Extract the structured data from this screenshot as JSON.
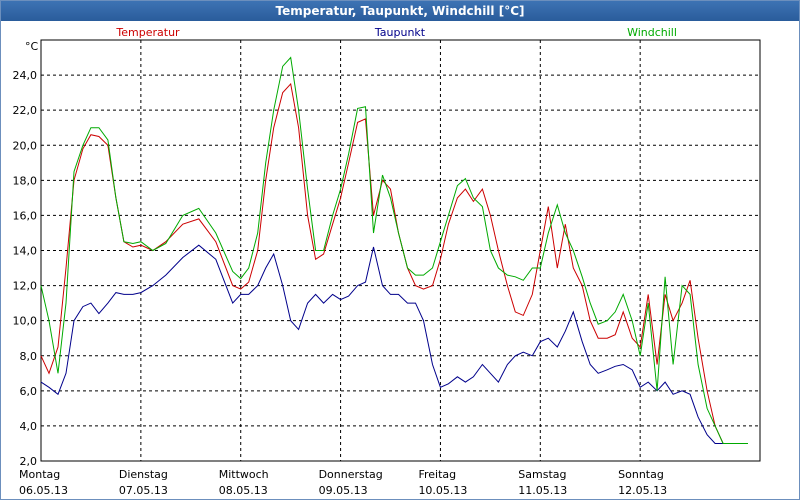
{
  "window": {
    "title": "Temperatur, Taupunkt, Windchill [°C]"
  },
  "chart_data": {
    "type": "line",
    "title": "Temperatur, Taupunkt, Windchill [°C]",
    "ylabel": "°C",
    "ylim": [
      2.0,
      26.0
    ],
    "xlim": [
      0,
      7.2
    ],
    "grid": true,
    "legend_position": "top",
    "y_ticks": [
      "2,0",
      "4,0",
      "6,0",
      "8,0",
      "10,0",
      "12,0",
      "14,0",
      "16,0",
      "18,0",
      "20,0",
      "22,0",
      "24,0"
    ],
    "x_ticks": [
      {
        "day": "Montag",
        "date": "06.05.13"
      },
      {
        "day": "Dienstag",
        "date": "07.05.13"
      },
      {
        "day": "Mittwoch",
        "date": "08.05.13"
      },
      {
        "day": "Donnerstag",
        "date": "09.05.13"
      },
      {
        "day": "Freitag",
        "date": "10.05.13"
      },
      {
        "day": "Samstag",
        "date": "11.05.13"
      },
      {
        "day": "Sonntag",
        "date": "12.05.13"
      }
    ],
    "series": [
      {
        "name": "Temperatur",
        "color": "#cc0000",
        "x": [
          0,
          0.08,
          0.17,
          0.25,
          0.33,
          0.42,
          0.5,
          0.58,
          0.67,
          0.75,
          0.83,
          0.92,
          1.0,
          1.12,
          1.25,
          1.42,
          1.58,
          1.75,
          1.92,
          2.0,
          2.08,
          2.17,
          2.25,
          2.33,
          2.42,
          2.5,
          2.58,
          2.67,
          2.75,
          2.83,
          2.92,
          3.0,
          3.08,
          3.17,
          3.25,
          3.33,
          3.42,
          3.5,
          3.58,
          3.67,
          3.75,
          3.83,
          3.92,
          4.0,
          4.08,
          4.17,
          4.25,
          4.33,
          4.42,
          4.5,
          4.58,
          4.67,
          4.75,
          4.83,
          4.92,
          5.0,
          5.08,
          5.17,
          5.25,
          5.33,
          5.42,
          5.5,
          5.58,
          5.67,
          5.75,
          5.83,
          5.92,
          6.0,
          6.08,
          6.17,
          6.25,
          6.33,
          6.42,
          6.5,
          6.58,
          6.67,
          6.75,
          6.83,
          6.92,
          7.0,
          7.08
        ],
        "values": [
          8.0,
          7.0,
          8.5,
          13.0,
          18.0,
          19.8,
          20.6,
          20.5,
          20.0,
          17.0,
          14.5,
          14.2,
          14.3,
          14.0,
          14.5,
          15.5,
          15.8,
          14.5,
          12.0,
          11.8,
          12.2,
          14.0,
          18.0,
          21.0,
          23.0,
          23.5,
          21.0,
          16.0,
          13.5,
          13.8,
          15.5,
          17.0,
          19.0,
          21.3,
          21.5,
          16.0,
          18.0,
          17.5,
          15.0,
          13.0,
          12.0,
          11.8,
          12.0,
          13.5,
          15.5,
          17.0,
          17.5,
          16.8,
          17.5,
          16.0,
          14.0,
          12.0,
          10.5,
          10.3,
          11.5,
          14.0,
          16.5,
          13.0,
          15.5,
          13.0,
          12.0,
          10.0,
          9.0,
          9.0,
          9.2,
          10.5,
          9.0,
          8.5,
          11.5,
          7.5,
          11.5,
          10.0,
          11.0,
          12.3,
          9.0,
          6.0,
          4.0,
          3.0,
          3.0,
          3.0,
          3.0
        ]
      },
      {
        "name": "Taupunkt",
        "color": "#00008b",
        "x": [
          0,
          0.08,
          0.17,
          0.25,
          0.33,
          0.42,
          0.5,
          0.58,
          0.67,
          0.75,
          0.83,
          0.92,
          1.0,
          1.12,
          1.25,
          1.42,
          1.58,
          1.75,
          1.92,
          2.0,
          2.08,
          2.17,
          2.25,
          2.33,
          2.42,
          2.5,
          2.58,
          2.67,
          2.75,
          2.83,
          2.92,
          3.0,
          3.08,
          3.17,
          3.25,
          3.33,
          3.42,
          3.5,
          3.58,
          3.67,
          3.75,
          3.83,
          3.92,
          4.0,
          4.08,
          4.17,
          4.25,
          4.33,
          4.42,
          4.5,
          4.58,
          4.67,
          4.75,
          4.83,
          4.92,
          5.0,
          5.08,
          5.17,
          5.25,
          5.33,
          5.42,
          5.5,
          5.58,
          5.67,
          5.75,
          5.83,
          5.92,
          6.0,
          6.08,
          6.17,
          6.25,
          6.33,
          6.42,
          6.5,
          6.58,
          6.67,
          6.75,
          6.83,
          6.92,
          7.0,
          7.08
        ],
        "values": [
          6.5,
          6.2,
          5.8,
          7.0,
          10.0,
          10.8,
          11.0,
          10.4,
          11.0,
          11.6,
          11.5,
          11.5,
          11.6,
          12.0,
          12.6,
          13.6,
          14.3,
          13.5,
          11.0,
          11.5,
          11.5,
          12.0,
          13.0,
          13.8,
          12.0,
          10.0,
          9.5,
          11.0,
          11.5,
          11.0,
          11.5,
          11.2,
          11.4,
          12.0,
          12.2,
          14.2,
          12.0,
          11.5,
          11.5,
          11.0,
          11.0,
          10.0,
          7.5,
          6.2,
          6.4,
          6.8,
          6.5,
          6.8,
          7.5,
          7.0,
          6.5,
          7.5,
          8.0,
          8.2,
          8.0,
          8.8,
          9.0,
          8.5,
          9.4,
          10.5,
          8.8,
          7.5,
          7.0,
          7.2,
          7.4,
          7.5,
          7.2,
          6.2,
          6.5,
          6.0,
          6.5,
          5.8,
          6.0,
          5.8,
          4.5,
          3.5,
          3.0,
          3.0,
          3.0,
          3.0,
          3.0
        ]
      },
      {
        "name": "Windchill",
        "color": "#00aa00",
        "x": [
          0,
          0.08,
          0.17,
          0.25,
          0.33,
          0.42,
          0.5,
          0.58,
          0.67,
          0.75,
          0.83,
          0.92,
          1.0,
          1.12,
          1.25,
          1.42,
          1.58,
          1.75,
          1.92,
          2.0,
          2.08,
          2.17,
          2.25,
          2.33,
          2.42,
          2.5,
          2.58,
          2.67,
          2.75,
          2.83,
          2.92,
          3.0,
          3.08,
          3.17,
          3.25,
          3.33,
          3.42,
          3.5,
          3.58,
          3.67,
          3.75,
          3.83,
          3.92,
          4.0,
          4.08,
          4.17,
          4.25,
          4.33,
          4.42,
          4.5,
          4.58,
          4.67,
          4.75,
          4.83,
          4.92,
          5.0,
          5.08,
          5.17,
          5.25,
          5.33,
          5.42,
          5.5,
          5.58,
          5.67,
          5.75,
          5.83,
          5.92,
          6.0,
          6.08,
          6.17,
          6.25,
          6.33,
          6.42,
          6.5,
          6.58,
          6.67,
          6.75,
          6.83,
          6.92,
          7.0,
          7.08
        ],
        "values": [
          12.0,
          10.0,
          7.0,
          11.0,
          18.5,
          20.0,
          21.0,
          21.0,
          20.3,
          17.0,
          14.5,
          14.4,
          14.5,
          14.0,
          14.4,
          16.0,
          16.4,
          15.0,
          12.8,
          12.4,
          13.0,
          15.0,
          19.0,
          22.0,
          24.5,
          25.0,
          22.0,
          17.5,
          14.0,
          14.0,
          16.0,
          17.5,
          19.5,
          22.1,
          22.2,
          15.0,
          18.3,
          17.0,
          15.0,
          13.0,
          12.6,
          12.6,
          13.0,
          14.5,
          16.0,
          17.7,
          18.1,
          17.0,
          16.5,
          14.0,
          13.0,
          12.6,
          12.5,
          12.3,
          13.0,
          13.0,
          15.0,
          16.6,
          15.0,
          14.0,
          12.5,
          11.0,
          9.8,
          10.0,
          10.5,
          11.5,
          10.0,
          8.0,
          11.0,
          6.0,
          12.5,
          7.5,
          12.0,
          11.5,
          7.5,
          5.0,
          4.0,
          3.0,
          3.0,
          3.0,
          3.0
        ]
      }
    ]
  }
}
